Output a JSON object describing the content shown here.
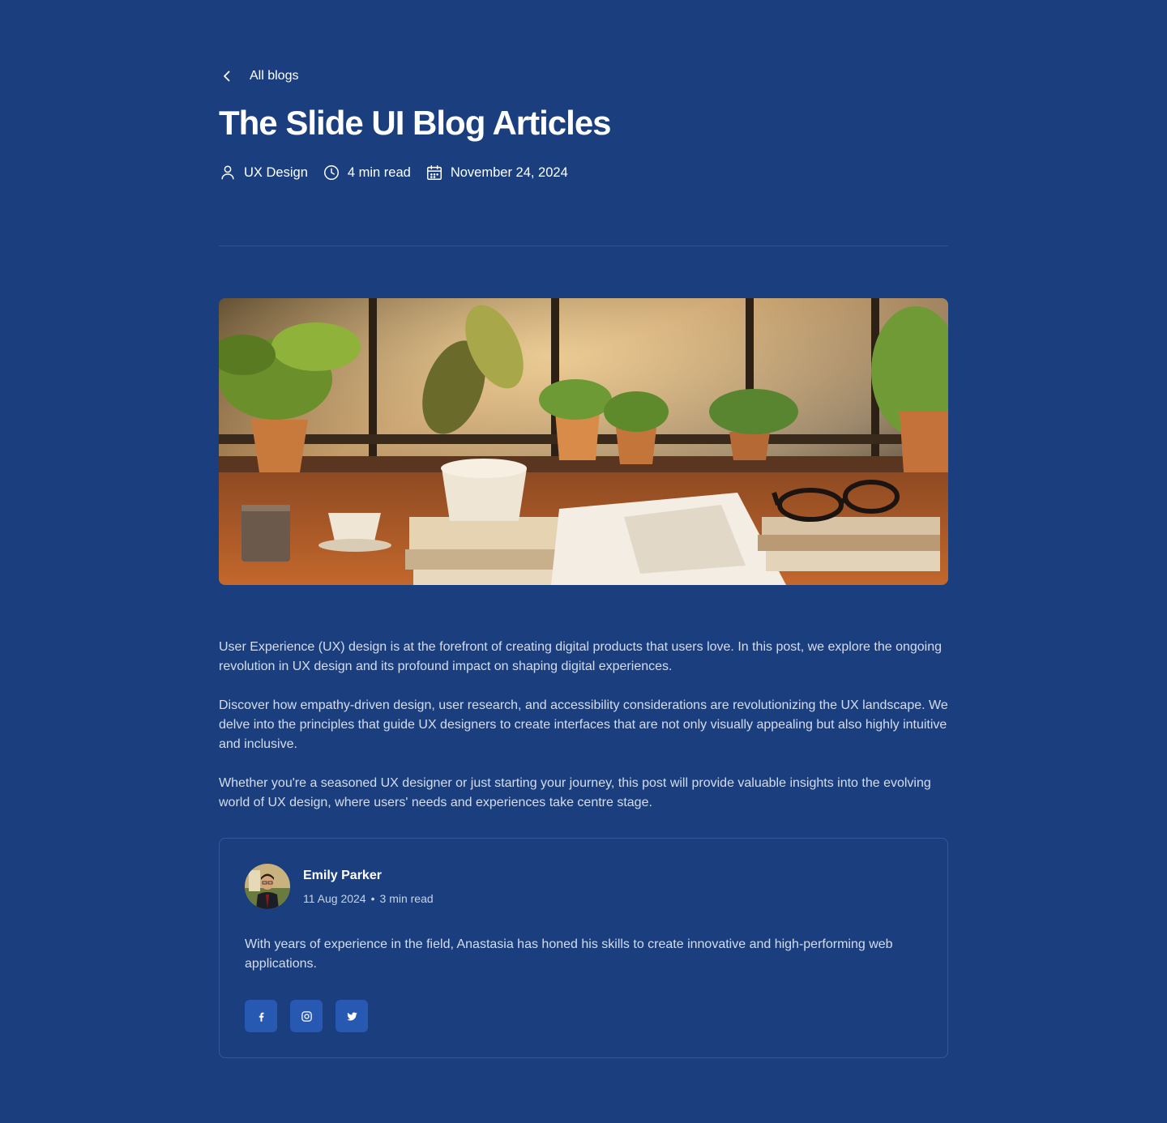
{
  "nav": {
    "back_label": "All blogs"
  },
  "post": {
    "title": "The Slide UI Blog Articles",
    "meta": {
      "category": "UX Design",
      "read_time": "4 min read",
      "date": "November 24, 2024"
    },
    "hero_image": "plants-desk-photo",
    "paragraphs": [
      "User Experience (UX) design is at the forefront of creating digital products that users love. In this post, we explore the ongoing revolution in UX design and its profound impact on shaping digital experiences.",
      "Discover how empathy-driven design, user research, and accessibility considerations are revolutionizing the UX landscape. We delve into the principles that guide UX designers to create interfaces that are not only visually appealing but also highly intuitive and inclusive.",
      "Whether you're a seasoned UX designer or just starting your journey, this post will provide valuable insights into the evolving world of UX design, where users' needs and experiences take centre stage."
    ]
  },
  "author": {
    "name": "Emily Parker",
    "date": "11 Aug 2024",
    "separator": "•",
    "read_time": "3 min read",
    "bio": "With years of experience in the field, Anastasia has honed his skills to create innovative and high-performing web applications.",
    "socials": [
      "facebook-icon",
      "instagram-icon",
      "twitter-icon"
    ]
  },
  "colors": {
    "background": "#1b3f7e",
    "social_button": "#2759b3",
    "divider": "#2f5496",
    "body_text": "#d3ddef"
  }
}
